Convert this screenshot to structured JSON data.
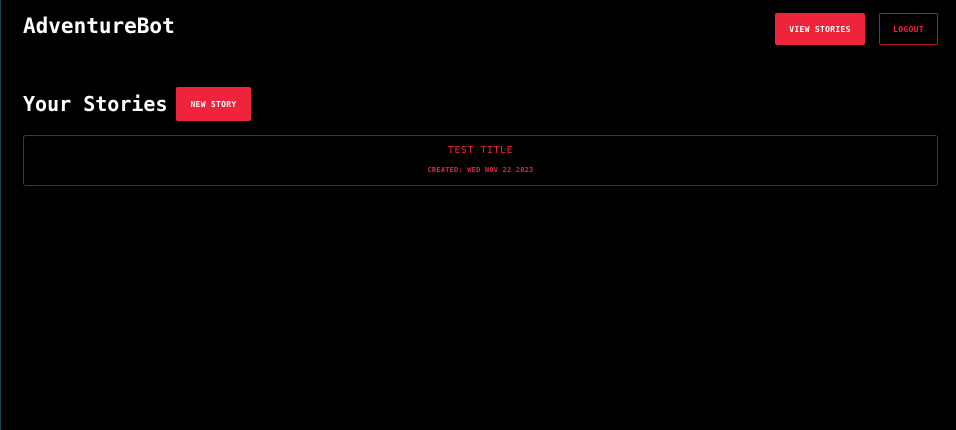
{
  "app": {
    "title": "AdventureBot"
  },
  "header": {
    "view_stories_label": "VIEW STORIES",
    "logout_label": "LOGOUT"
  },
  "main": {
    "heading": "Your Stories",
    "new_story_label": "NEW STORY",
    "stories": [
      {
        "title": "TEST TITLE",
        "created": "CREATED: WED NOV 22 2023"
      }
    ]
  },
  "colors": {
    "background": "#000000",
    "accent": "#ef233c",
    "text": "#ffffff"
  }
}
